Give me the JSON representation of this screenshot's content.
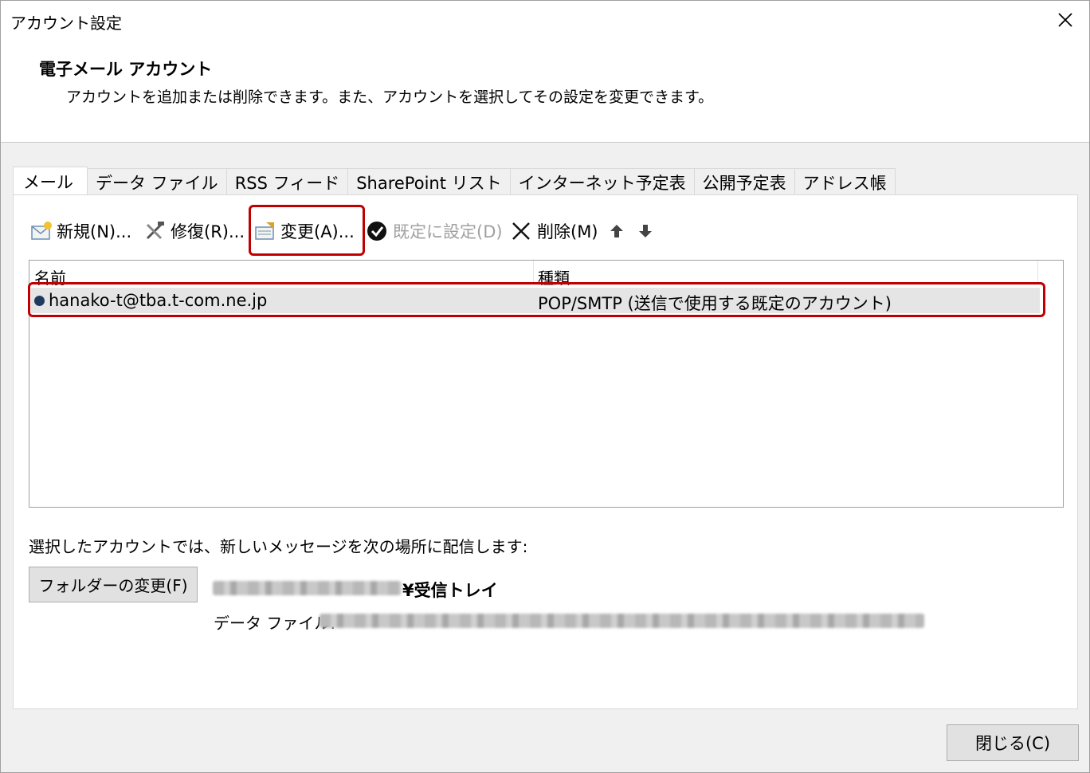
{
  "window": {
    "title": "アカウント設定"
  },
  "header": {
    "title": "電子メール アカウント",
    "description": "アカウントを追加または削除できます。また、アカウントを選択してその設定を変更できます。"
  },
  "tabs": [
    {
      "label": "メール",
      "active": true
    },
    {
      "label": "データ ファイル"
    },
    {
      "label": "RSS フィード"
    },
    {
      "label": "SharePoint リスト"
    },
    {
      "label": "インターネット予定表"
    },
    {
      "label": "公開予定表"
    },
    {
      "label": "アドレス帳"
    }
  ],
  "toolbar": {
    "new_label": "新規(N)...",
    "repair_label": "修復(R)...",
    "change_label": "変更(A)...",
    "set_default_label": "既定に設定(D)",
    "delete_label": "削除(M)"
  },
  "list": {
    "columns": {
      "name": "名前",
      "type": "種類"
    },
    "rows": [
      {
        "name": "hanako-t@tba.t-com.ne.jp",
        "type": "POP/SMTP (送信で使用する既定のアカウント)"
      }
    ]
  },
  "delivery": {
    "label": "選択したアカウントでは、新しいメッセージを次の場所に配信します:",
    "folder_button": "フォルダーの変更(F)",
    "inbox_suffix": "¥受信トレイ",
    "datafile_label": "データ ファイル:"
  },
  "footer": {
    "close_button": "閉じる(C)"
  },
  "colors": {
    "highlight": "#c00000",
    "selected_row": "#e5e5e5"
  }
}
